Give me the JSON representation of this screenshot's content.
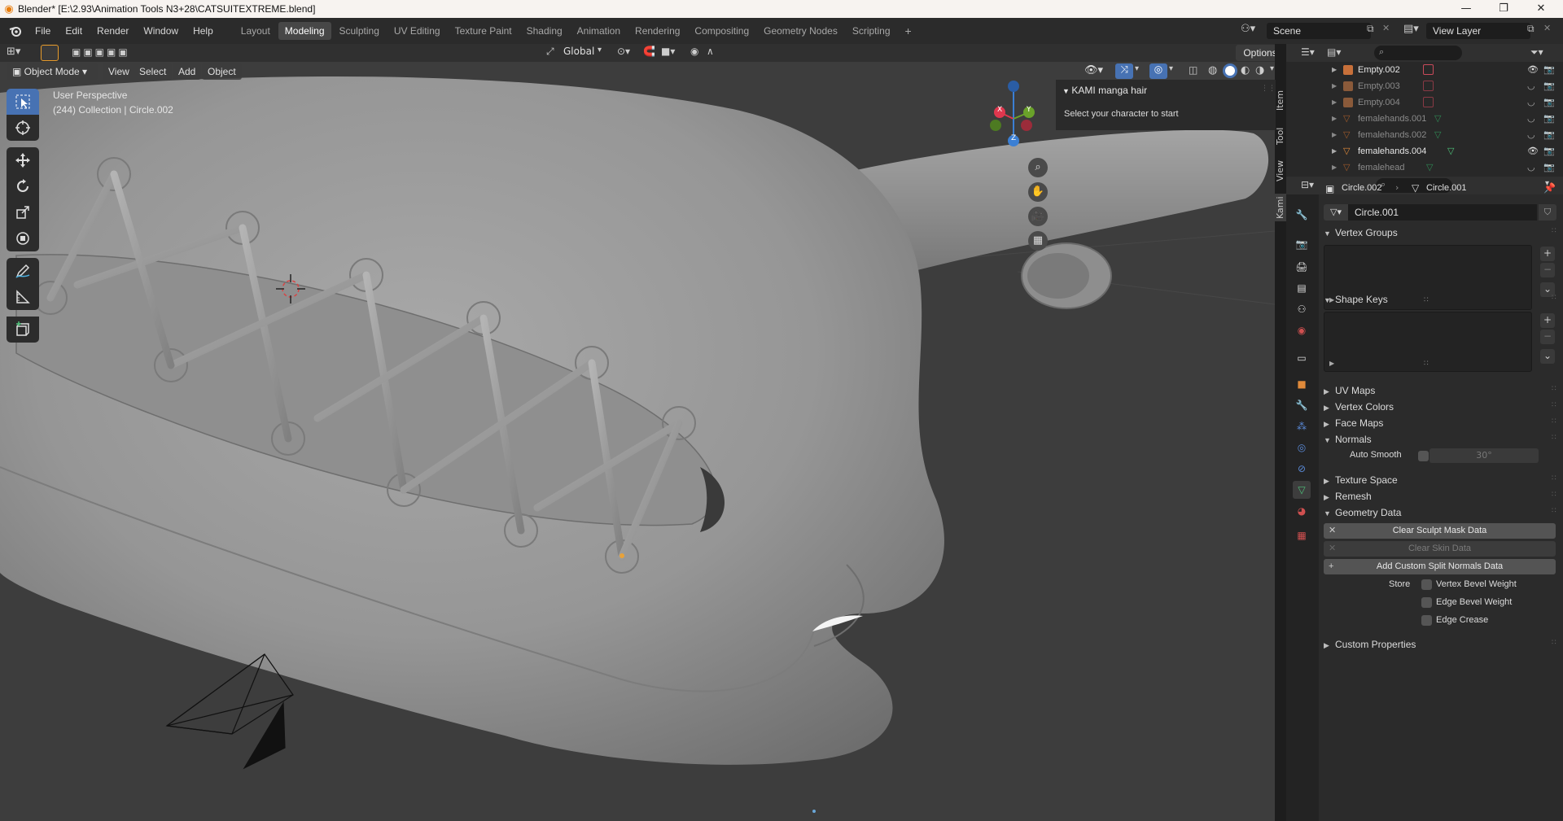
{
  "window": {
    "title": "Blender* [E:\\2.93\\Animation Tools N3+28\\CATSUITEXTREME.blend]",
    "controls": {
      "minimize": "—",
      "maximize": "❐",
      "close": "✕"
    }
  },
  "menu": [
    "File",
    "Edit",
    "Render",
    "Window",
    "Help"
  ],
  "workspaces": [
    "Layout",
    "Modeling",
    "Sculpting",
    "UV Editing",
    "Texture Paint",
    "Shading",
    "Animation",
    "Rendering",
    "Compositing",
    "Geometry Nodes",
    "Scripting"
  ],
  "active_workspace": "Modeling",
  "scene": {
    "name": "Scene",
    "view_layer": "View Layer"
  },
  "viewport_header": {
    "transform_orientation": "Global",
    "options_label": "Options",
    "mode": "Object Mode",
    "menus": [
      "View",
      "Select",
      "Add",
      "Object"
    ]
  },
  "viewport": {
    "perspective": "User Perspective",
    "collection_info": "(244) Collection | Circle.002",
    "gizmo_axes": {
      "x": "X",
      "y": "Y",
      "z": "Z"
    }
  },
  "npanel": {
    "panel_title": "KAMI manga hair",
    "message": "Select your character to start",
    "tabs": [
      "Item",
      "Tool",
      "View",
      "Kami"
    ]
  },
  "outliner": {
    "rows": [
      {
        "name": "Empty.002",
        "type": "empty",
        "visible": true
      },
      {
        "name": "Empty.003",
        "type": "empty",
        "visible": false
      },
      {
        "name": "Empty.004",
        "type": "empty",
        "visible": false
      },
      {
        "name": "femalehands.001",
        "type": "mesh",
        "visible": false
      },
      {
        "name": "femalehands.002",
        "type": "mesh",
        "visible": false
      },
      {
        "name": "femalehands.004",
        "type": "mesh",
        "visible": true
      },
      {
        "name": "femalehead",
        "type": "mesh",
        "visible": false
      }
    ]
  },
  "properties": {
    "breadcrumb": {
      "object": "Circle.002",
      "data": "Circle.001"
    },
    "data_name": "Circle.001",
    "sections": {
      "vertex_groups": "Vertex Groups",
      "shape_keys": "Shape Keys",
      "uv_maps": "UV Maps",
      "vertex_colors": "Vertex Colors",
      "face_maps": "Face Maps",
      "normals": "Normals",
      "texture_space": "Texture Space",
      "remesh": "Remesh",
      "geometry_data": "Geometry Data",
      "custom_properties": "Custom Properties"
    },
    "normals": {
      "auto_smooth_label": "Auto Smooth",
      "angle": "30°"
    },
    "geometry_data": {
      "clear_sculpt_mask": "Clear Sculpt Mask Data",
      "clear_skin": "Clear Skin Data",
      "add_custom_split": "Add Custom Split Normals Data",
      "store_label": "Store",
      "vertex_bevel_weight": "Vertex Bevel Weight",
      "edge_bevel_weight": "Edge Bevel Weight",
      "edge_crease": "Edge Crease"
    }
  },
  "colors": {
    "accent": "#4772b3",
    "axis_x": "#e0374e",
    "axis_y": "#6aa22a",
    "axis_z": "#3b7fd4",
    "mesh_data_icon": "#4ec27a"
  }
}
